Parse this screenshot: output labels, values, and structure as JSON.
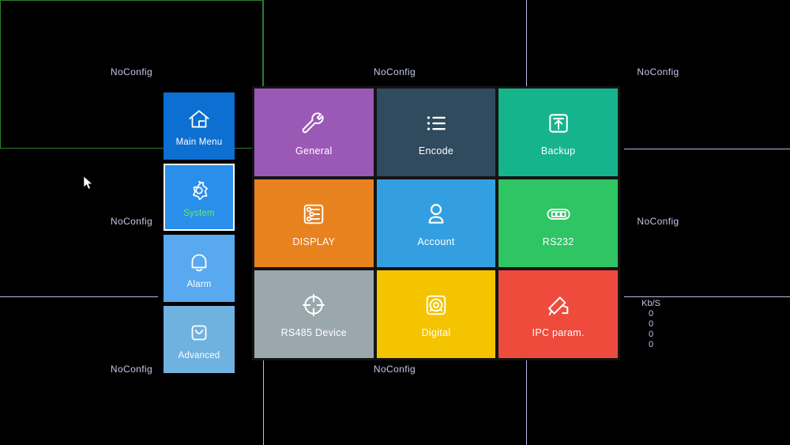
{
  "background": {
    "pane_label": "NoConfig",
    "panes": [
      {
        "label": "NoConfig",
        "selected": true
      },
      {
        "label": "NoConfig",
        "selected": false
      },
      {
        "label": "NoConfig",
        "selected": false
      },
      {
        "label": "NoConfig",
        "selected": false
      },
      {
        "label": "",
        "selected": false
      },
      {
        "label": "NoConfig",
        "selected": false
      },
      {
        "label": "NoConfig",
        "selected": false
      },
      {
        "label": "NoConfig",
        "selected": false
      },
      {
        "label": "",
        "selected": false
      }
    ],
    "selected_border_color": "#2d7d2d",
    "divider_color": "#b9b8e6",
    "label_color": "#c3c8e8"
  },
  "bitrate": {
    "unit": "Kb/S",
    "values": [
      "0",
      "0",
      "0",
      "0"
    ]
  },
  "sidebar": {
    "items": [
      {
        "label": "Main Menu",
        "icon": "home-icon",
        "color": "#0d6fd1",
        "selected": false
      },
      {
        "label": "System",
        "icon": "gear-icon",
        "color": "#2a8fea",
        "selected": true
      },
      {
        "label": "Alarm",
        "icon": "bell-icon",
        "color": "#58a9ef",
        "selected": false
      },
      {
        "label": "Advanced",
        "icon": "tools-icon",
        "color": "#6fb1df",
        "selected": false
      }
    ],
    "selected_label_color": "#5cf06a"
  },
  "menu": {
    "tiles": [
      {
        "label": "General",
        "icon": "wrench-icon",
        "color": "#9b59b6",
        "text_color": "#ffffff"
      },
      {
        "label": "Encode",
        "icon": "list-icon",
        "color": "#304a5e",
        "text_color": "#ffffff"
      },
      {
        "label": "Backup",
        "icon": "upload-box-icon",
        "color": "#16b48c",
        "text_color": "#ffffff"
      },
      {
        "label": "DISPLAY",
        "icon": "sliders-icon",
        "color": "#e8821e",
        "text_color": "#ffffff"
      },
      {
        "label": "Account",
        "icon": "user-icon",
        "color": "#349fe0",
        "text_color": "#ffffff"
      },
      {
        "label": "RS232",
        "icon": "connector-icon",
        "color": "#2fc464",
        "text_color": "#ffffff"
      },
      {
        "label": "RS485 Device",
        "icon": "crosshair-icon",
        "color": "#9aa8ad",
        "text_color": "#ffffff"
      },
      {
        "label": "Digital",
        "icon": "lens-icon",
        "color": "#f5c400",
        "text_color": "#ffffff"
      },
      {
        "label": "IPC param.",
        "icon": "camera-icon",
        "color": "#ee4b3d",
        "text_color": "#ffffff"
      }
    ]
  }
}
